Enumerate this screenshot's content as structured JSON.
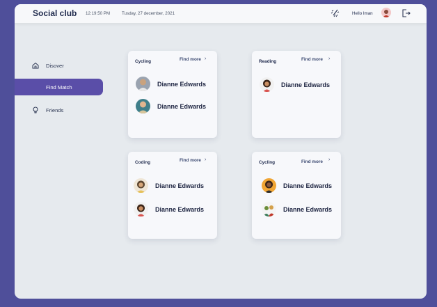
{
  "app": {
    "title": "Social club",
    "time": "12:19:50 PM",
    "date": "Tusday, 27 december, 2021",
    "greeting": "Hello Iman"
  },
  "icons": {
    "weather": "weather-icon",
    "avatar": "user-avatar",
    "logout": "logout-icon"
  },
  "sidebar": {
    "items": [
      {
        "label": "Disover",
        "icon": "home-icon",
        "active": false
      },
      {
        "label": "Find Match",
        "icon": "",
        "active": true
      },
      {
        "label": "Friends",
        "icon": "lightbulb-icon",
        "active": false
      }
    ]
  },
  "cards": [
    {
      "title": "Cycling",
      "more": "Find more",
      "people": [
        {
          "name": "Dianne Edwards"
        },
        {
          "name": "Dianne Edwards"
        }
      ]
    },
    {
      "title": "Reading",
      "more": "Find more",
      "people": [
        {
          "name": "Dianne Edwards"
        }
      ]
    },
    {
      "title": "Coding",
      "more": "Find more",
      "people": [
        {
          "name": "Dianne Edwards"
        },
        {
          "name": "Dianne Edwards"
        }
      ]
    },
    {
      "title": "Cycling",
      "more": "Find more",
      "people": [
        {
          "name": "Dianne Edwards"
        },
        {
          "name": "Dianne Edwards"
        }
      ]
    }
  ],
  "colors": {
    "accent": "#5a4ea8",
    "background": "#4f4f9a",
    "panel": "#e6eaee"
  }
}
